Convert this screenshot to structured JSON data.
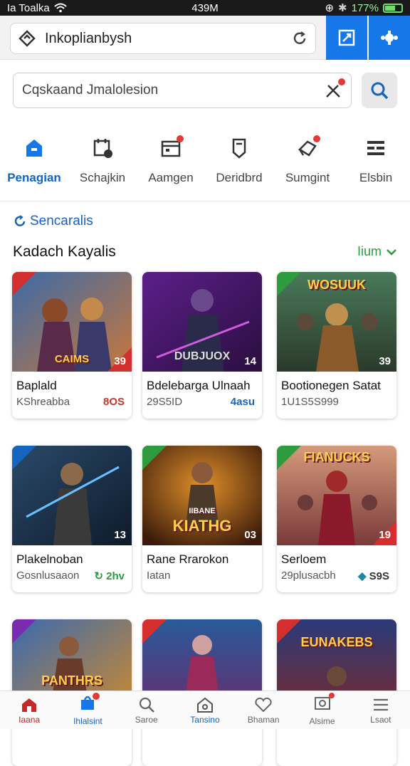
{
  "status": {
    "carrier": "Ia Toalka",
    "time": "439M",
    "battery": "177%"
  },
  "browser": {
    "url": "Inkoplianbysh"
  },
  "search": {
    "value": "Cqskaand Jmalolesion"
  },
  "categories": [
    {
      "label": "Penagian",
      "icon": "store-icon"
    },
    {
      "label": "Schajkin",
      "icon": "repeat-icon"
    },
    {
      "label": "Aamgen",
      "icon": "calendar-icon"
    },
    {
      "label": "Deridbrd",
      "icon": "bookmark-icon"
    },
    {
      "label": "Sumgint",
      "icon": "announce-icon"
    },
    {
      "label": "Elsbin",
      "icon": "list-icon"
    }
  ],
  "section": {
    "tag": "Sencaralis",
    "title": "Kadach Kayalis",
    "see_all": "Iium"
  },
  "cards": [
    {
      "title": "Baplald",
      "sub": "KShreabba",
      "meta": "8OS",
      "logo": "CAIMS",
      "num": "39",
      "metaColor": "#c0392b"
    },
    {
      "title": "Bdelebarga Ulnaah",
      "sub": "29S5ID",
      "meta": "4asu",
      "logo": "DUBJUOX",
      "num": "14",
      "metaColor": "#1565c0"
    },
    {
      "title": "Bootionegen Satat",
      "sub": "1U1S5S999",
      "meta": "",
      "logo": "WOSUUK",
      "num": "39",
      "metaColor": "#333"
    },
    {
      "title": "Plakelnoban",
      "sub": "Gosnlusaaon",
      "meta": "2hv",
      "logo": "",
      "num": "13",
      "metaColor": "#2e9b3e"
    },
    {
      "title": "Rane Rrarokon",
      "sub": "Iatan",
      "meta": "",
      "logo": "KIATHG",
      "logo_top": "IIBANE",
      "num": "03",
      "metaColor": "#333"
    },
    {
      "title": "Serloem",
      "sub": "29plusacbh",
      "meta": "S9S",
      "logo": "FIANUCKS",
      "num": "19",
      "metaColor": "#333"
    },
    {
      "title": "",
      "sub": "",
      "meta": "",
      "logo": "PANTHRS",
      "num": "",
      "metaColor": "#333"
    },
    {
      "title": "",
      "sub": "",
      "meta": "",
      "logo": "",
      "num": "",
      "metaColor": "#333"
    },
    {
      "title": "",
      "sub": "",
      "meta": "",
      "logo": "EUNAKEBS",
      "num": "",
      "metaColor": "#333"
    }
  ],
  "bottom_nav": [
    {
      "label": "Iaana",
      "icon": "home-icon"
    },
    {
      "label": "Ihlalsint",
      "icon": "bag-icon"
    },
    {
      "label": "Saroe",
      "icon": "search-icon"
    },
    {
      "label": "Tansino",
      "icon": "house-outline-icon"
    },
    {
      "label": "Bhaman",
      "icon": "heart-icon"
    },
    {
      "label": "Alsime",
      "icon": "camera-icon"
    },
    {
      "label": "Lsaot",
      "icon": "menu-icon"
    }
  ]
}
